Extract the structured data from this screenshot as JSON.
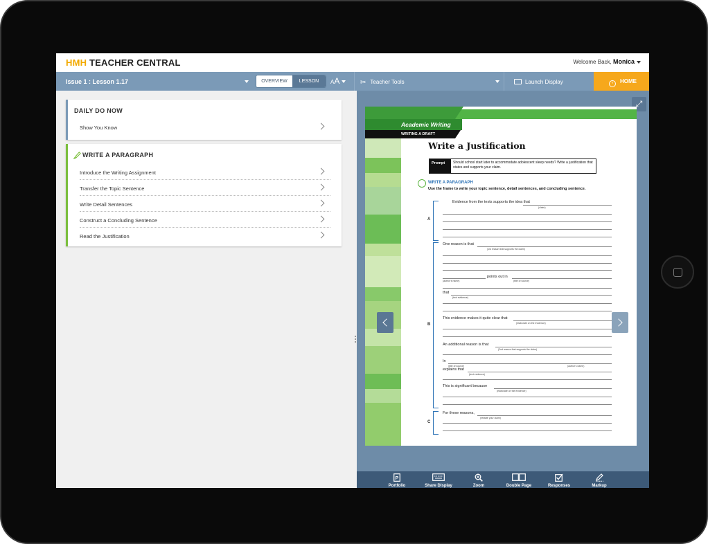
{
  "app": {
    "brand_prefix": "HMH",
    "brand_rest": " TEACHER CENTRAL",
    "welcome_text": "Welcome Back,",
    "user_name": "Monica"
  },
  "nav": {
    "lesson": "Issue 1 : Lesson 1.17",
    "toggle_overview": "OVERVIEW",
    "toggle_lesson": "LESSON",
    "font_big": "A",
    "font_small": "A",
    "tools": "Teacher Tools",
    "launch": "Launch Display",
    "home": "HOME"
  },
  "cards": {
    "daily": {
      "title": "DAILY DO NOW",
      "items": [
        "Show You Know"
      ]
    },
    "write": {
      "title": "WRITE A PARAGRAPH",
      "items": [
        "Introduce the Writing Assignment",
        "Transfer the Topic Sentence",
        "Write Detail Sentences",
        "Construct a Concluding Sentence",
        "Read the Justification"
      ]
    }
  },
  "page": {
    "section": "Academic Writing",
    "subsection": "WRITING A DRAFT",
    "heading": "Write a Justification",
    "prompt_label": "Prompt",
    "prompt_text": "Should school start later to accommodate adolescent sleep needs? Write a justification that states and supports your claim.",
    "wp_title": "WRITE A PARAGRAPH",
    "wp_instr": "Use the frame to write your topic sentence, detail sentences, and concluding sentence.",
    "letters": [
      "A",
      "B",
      "C"
    ],
    "frames": {
      "a1": "Evidence from the texts supports the idea that",
      "a1_cap": "(claim)",
      "b1": "One reason is that",
      "b1_cap": "(1st reason that supports the claim)",
      "b2": "points out in",
      "b2_cap1": "(author's name)",
      "b2_cap2": "(title of source)",
      "b3": "that",
      "b3_cap": "(text evidence)",
      "b4": "This evidence makes it quite clear that",
      "b4_cap": "(elaborate on the evidence)",
      "b5": "An additional reason is that",
      "b5_cap": "(2nd reason that supports the claim)",
      "b6": "In",
      "b6_cap1": "(title of source)",
      "b6_cap2": "(author's name)",
      "b7": "explains that",
      "b7_cap": "(text evidence)",
      "b8": "This is significant because",
      "b8_cap": "(elaborate on the evidence)",
      "c1": "For these reasons,",
      "c1_cap": "(restate your claim)"
    }
  },
  "toolbar": {
    "items": [
      {
        "label": "Portfolio",
        "icon": "portfolio-icon"
      },
      {
        "label": "Share Display",
        "icon": "keyboard-display-icon"
      },
      {
        "label": "Zoom",
        "icon": "zoom-icon"
      },
      {
        "label": "Double Page",
        "icon": "double-page-icon"
      },
      {
        "label": "Responses",
        "icon": "checkbox-icon"
      },
      {
        "label": "Markup",
        "icon": "pen-markup-icon"
      }
    ]
  },
  "colors": {
    "nav_bg": "#7b9ab7",
    "home_orange": "#f6a81c",
    "brand_yellow": "#f2a900",
    "card_accent_green": "#7bbf3c",
    "toolbar_bg": "#3d5a78"
  }
}
